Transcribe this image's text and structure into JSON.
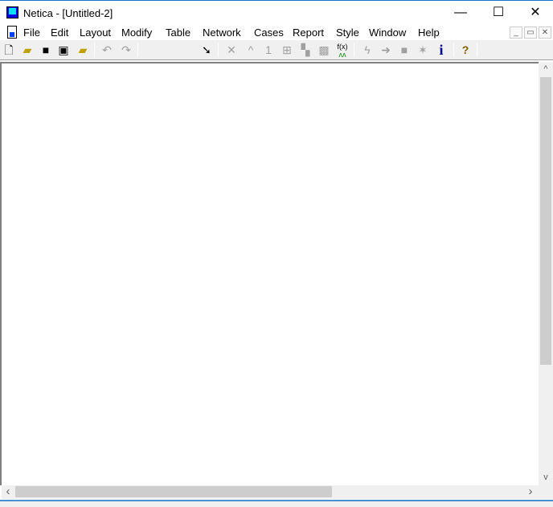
{
  "window": {
    "title": "Netica - [Untitled-2]",
    "minimize": "—",
    "maximize": "☐",
    "close": "✕"
  },
  "menu": [
    "File",
    "Edit",
    "Layout",
    "Modify",
    "Table",
    "Network",
    "Cases",
    "Report",
    "Style",
    "Window",
    "Help"
  ],
  "mdi_controls": {
    "minimize": "_",
    "restore": "▭",
    "close": "✕"
  },
  "toolbar": {
    "icons": [
      "new-file",
      "open-folder",
      "save",
      "save-all",
      "open-special",
      "undo",
      "redo",
      "ellipse-node",
      "rectangle-node",
      "hexagon-node",
      "arrow-link",
      "delete-links",
      "reverse-link",
      "number",
      "absorb",
      "sensitivity",
      "remove",
      "equation",
      "compile",
      "go",
      "place",
      "star",
      "info",
      "help"
    ],
    "equation_label": "f(x)",
    "info_label": "i",
    "help_label": "?"
  },
  "scrollbars": {
    "left": "‹",
    "right": "›",
    "up": "^",
    "down": "v"
  }
}
